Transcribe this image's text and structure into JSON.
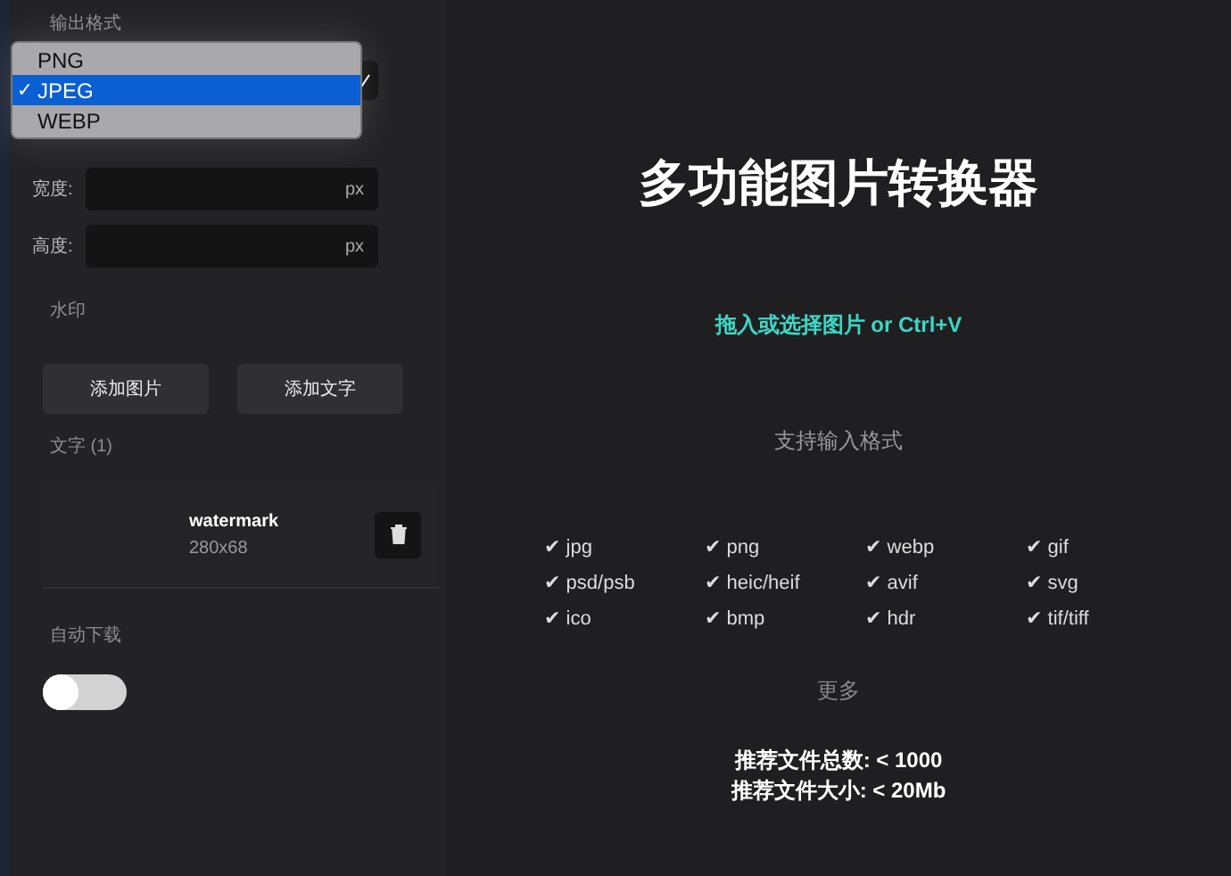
{
  "sidebar": {
    "output_format": {
      "label": "输出格式",
      "options": [
        {
          "label": "PNG",
          "selected": false
        },
        {
          "label": "JPEG",
          "selected": true,
          "check": "✓"
        },
        {
          "label": "WEBP",
          "selected": false
        }
      ]
    },
    "size_fields": [
      {
        "label": "宽度:",
        "unit": "px"
      },
      {
        "label": "高度:",
        "unit": "px"
      }
    ],
    "watermark": {
      "label": "水印",
      "buttons": [
        "添加图片",
        "添加文字"
      ],
      "list_label": "文字 (1)",
      "items": [
        {
          "name": "watermark",
          "size": "280x68"
        }
      ]
    },
    "auto_download": {
      "label": "自动下载",
      "on": false
    }
  },
  "main": {
    "title": "多功能图片转换器",
    "drop_hint": "拖入或选择图片 or Ctrl+V",
    "formats_title": "支持输入格式",
    "formats": [
      {
        "mark": "✔",
        "name": "jpg"
      },
      {
        "mark": "✔",
        "name": "png"
      },
      {
        "mark": "✔",
        "name": "webp"
      },
      {
        "mark": "✔",
        "name": "gif"
      },
      {
        "mark": "✔",
        "name": "psd/psb"
      },
      {
        "mark": "✔",
        "name": "heic/heif"
      },
      {
        "mark": "✔",
        "name": "avif"
      },
      {
        "mark": "✔",
        "name": "svg"
      },
      {
        "mark": "✔",
        "name": "ico"
      },
      {
        "mark": "✔",
        "name": "bmp"
      },
      {
        "mark": "✔",
        "name": "hdr"
      },
      {
        "mark": "✔",
        "name": "tif/tiff"
      }
    ],
    "more": "更多",
    "limits": [
      "推荐文件总数: < 1000",
      "推荐文件大小: < 20Mb"
    ]
  }
}
